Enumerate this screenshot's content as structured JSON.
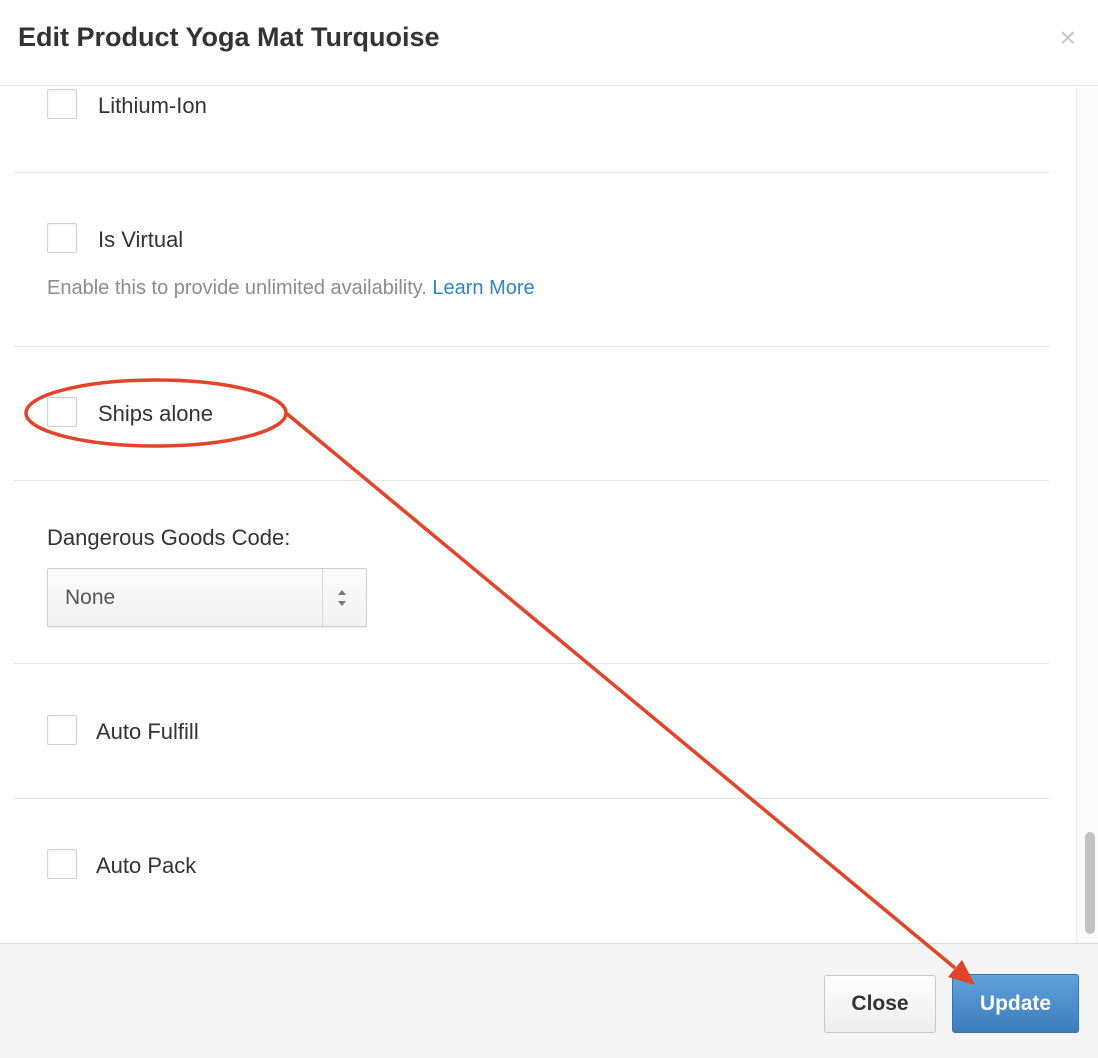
{
  "dialog": {
    "title": "Edit Product Yoga Mat Turquoise",
    "close_symbol": "×"
  },
  "fields": {
    "lithium_ion": {
      "label": "Lithium-Ion",
      "checked": false
    },
    "is_virtual": {
      "label": "Is Virtual",
      "checked": false,
      "help_text": "Enable this to provide unlimited availability.",
      "help_link": "Learn More"
    },
    "ships_alone": {
      "label": "Ships alone",
      "checked": false
    },
    "dangerous_goods": {
      "label": "Dangerous Goods Code:",
      "selected": "None"
    },
    "auto_fulfill": {
      "label": "Auto Fulfill",
      "checked": false
    },
    "auto_pack": {
      "label": "Auto Pack",
      "checked": false
    }
  },
  "footer": {
    "close_label": "Close",
    "update_label": "Update"
  },
  "colors": {
    "link": "#2f86c5",
    "primary_button": "#4a8ccb",
    "annotation": "#e2432a"
  },
  "icons": [
    "close-icon",
    "select-arrows-icon"
  ]
}
